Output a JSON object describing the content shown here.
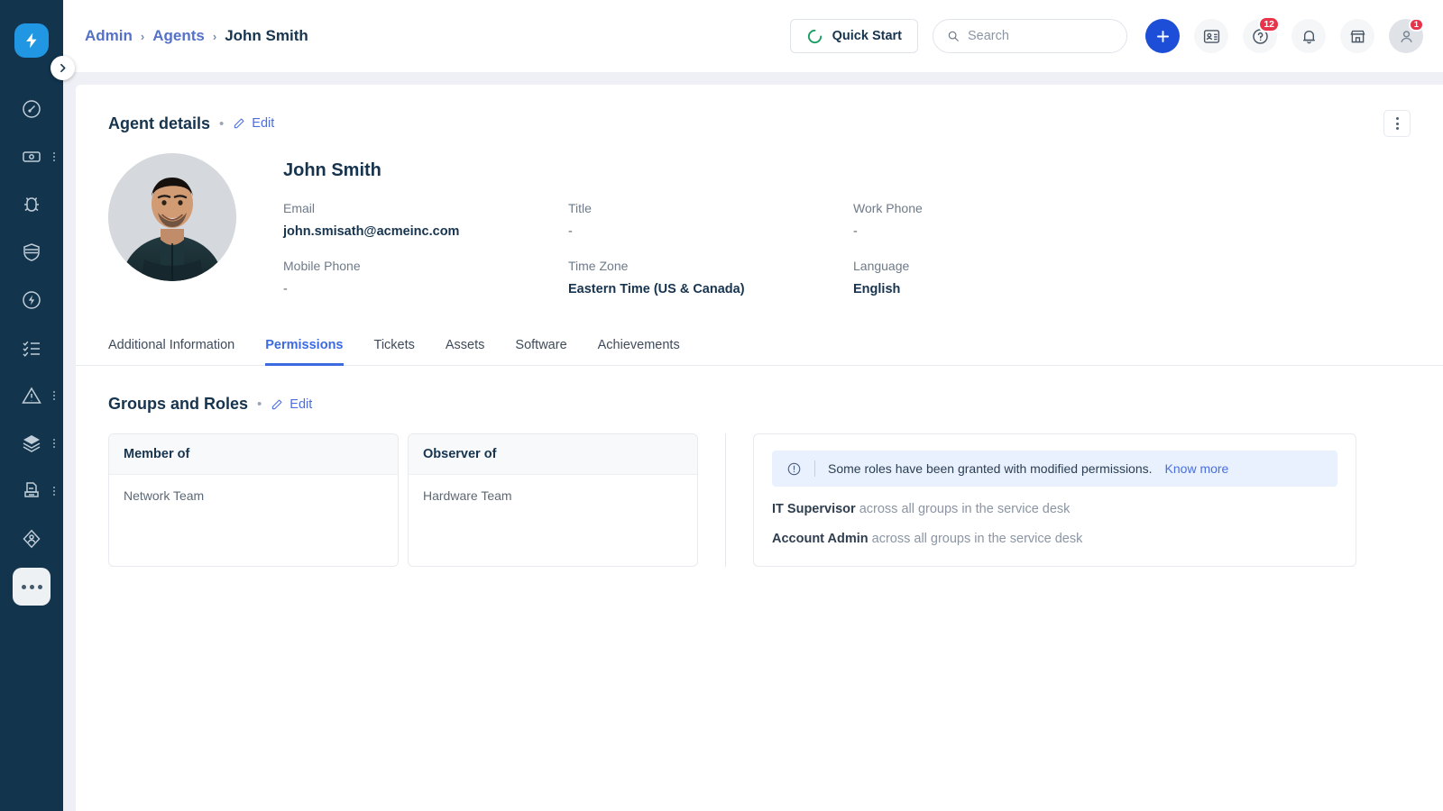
{
  "sidebar": {
    "logo_icon": "lightning-bolt-logo",
    "expander_icon": "chevron-right-icon",
    "items": [
      {
        "icon": "dashboard-gauge-icon",
        "name": "dashboard",
        "has_overflow": false
      },
      {
        "icon": "ticket-icon",
        "name": "tickets",
        "has_overflow": true
      },
      {
        "icon": "bug-icon",
        "name": "problems",
        "has_overflow": false
      },
      {
        "icon": "shield-icon",
        "name": "changes",
        "has_overflow": false
      },
      {
        "icon": "bolt-circle-icon",
        "name": "releases",
        "has_overflow": false
      },
      {
        "icon": "checklist-icon",
        "name": "tasks",
        "has_overflow": false
      },
      {
        "icon": "warning-triangle-icon",
        "name": "incidents",
        "has_overflow": true
      },
      {
        "icon": "layers-icon",
        "name": "assets",
        "has_overflow": true
      },
      {
        "icon": "document-printer-icon",
        "name": "contracts",
        "has_overflow": true
      },
      {
        "icon": "workflow-node-icon",
        "name": "automation",
        "has_overflow": false
      }
    ],
    "more_label": "More"
  },
  "topbar": {
    "breadcrumb": {
      "items": [
        {
          "label": "Admin",
          "link": true
        },
        {
          "label": "Agents",
          "link": true
        },
        {
          "label": "John Smith",
          "link": false
        }
      ],
      "separator": "›"
    },
    "quick_start": {
      "label": "Quick Start",
      "icon": "spinner-circle-icon",
      "color": "#1a9f62"
    },
    "search": {
      "placeholder": "Search",
      "value": "",
      "icon": "search-icon"
    },
    "add_button": {
      "icon": "plus-icon",
      "color": "#1d4ed8"
    },
    "icons": [
      {
        "name": "contact-card-icon",
        "badge": ""
      },
      {
        "name": "help-question-icon",
        "badge": "12"
      },
      {
        "name": "bell-icon",
        "badge": ""
      },
      {
        "name": "marketplace-store-icon",
        "badge": ""
      },
      {
        "name": "user-avatar-icon",
        "badge": "1"
      }
    ],
    "badge_color": "#e8344a"
  },
  "agent_details": {
    "title": "Agent details",
    "separator": "•",
    "edit_label": "Edit",
    "edit_icon": "pencil-icon",
    "kebab_icon": "more-vertical-icon",
    "name": "John Smith",
    "avatar_alt": "John Smith profile photo",
    "fields": [
      {
        "label": "Email",
        "value": "john.smisath@acmeinc.com",
        "empty": false
      },
      {
        "label": "Title",
        "value": "-",
        "empty": true
      },
      {
        "label": "Work Phone",
        "value": "-",
        "empty": true
      },
      {
        "label": "Mobile Phone",
        "value": "-",
        "empty": true
      },
      {
        "label": "Time Zone",
        "value": "Eastern Time (US & Canada)",
        "empty": false
      },
      {
        "label": "Language",
        "value": "English",
        "empty": false
      }
    ]
  },
  "tabs": [
    {
      "label": "Additional Information",
      "active": false
    },
    {
      "label": "Permissions",
      "active": true
    },
    {
      "label": "Tickets",
      "active": false
    },
    {
      "label": "Assets",
      "active": false
    },
    {
      "label": "Software",
      "active": false
    },
    {
      "label": "Achievements",
      "active": false
    }
  ],
  "groups_and_roles": {
    "title": "Groups and Roles",
    "separator": "•",
    "edit_label": "Edit",
    "edit_icon": "pencil-icon",
    "member_of": {
      "header": "Member of",
      "items": [
        "Network Team"
      ]
    },
    "observer_of": {
      "header": "Observer of",
      "items": [
        "Hardware Team"
      ]
    },
    "banner": {
      "icon": "info-circle-icon",
      "text": "Some roles have been granted with modified permissions.",
      "link_label": "Know more",
      "bg": "#e8f1fd"
    },
    "roles": [
      {
        "name": "IT Supervisor",
        "scope": "across all groups in the service desk"
      },
      {
        "name": "Account Admin",
        "scope": "across all groups in the service desk"
      }
    ]
  }
}
